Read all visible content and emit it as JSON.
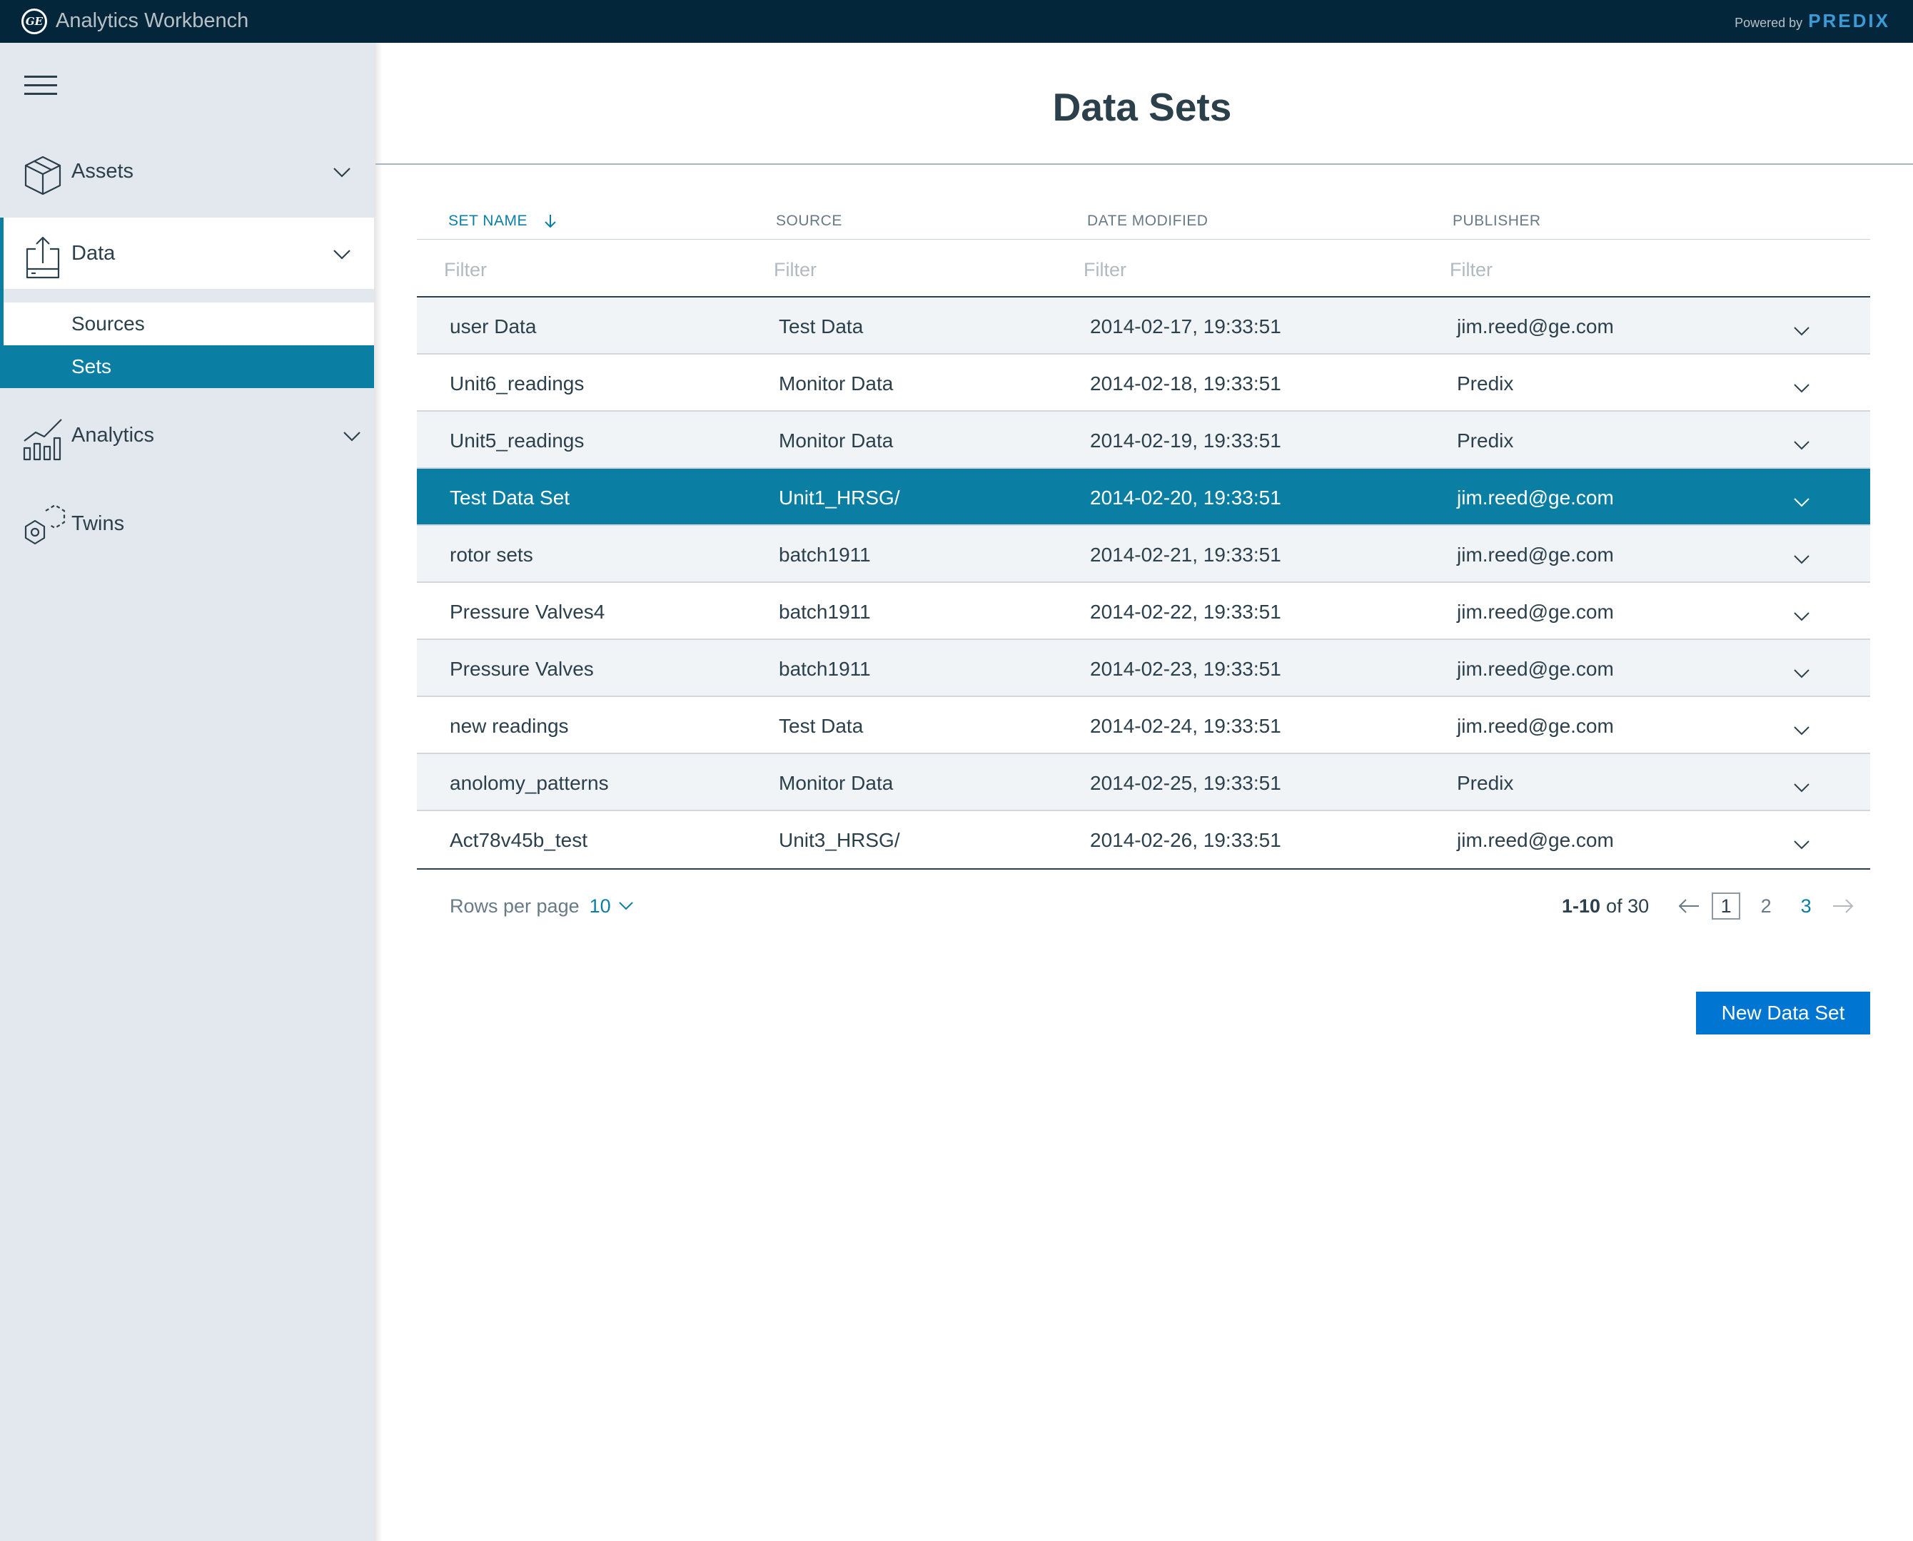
{
  "header": {
    "logo_text": "GE",
    "app_title": "Analytics Workbench",
    "powered_label": "Powered by",
    "powered_brand": "PREDIX"
  },
  "sidebar": {
    "items": [
      {
        "label": "Assets",
        "icon": "cube-icon",
        "expanded": false
      },
      {
        "label": "Data",
        "icon": "data-upload-icon",
        "expanded": true,
        "children": [
          {
            "label": "Sources",
            "selected": false
          },
          {
            "label": "Sets",
            "selected": true
          }
        ]
      },
      {
        "label": "Analytics",
        "icon": "bar-line-chart-icon",
        "expanded": false
      },
      {
        "label": "Twins",
        "icon": "twins-hexagon-icon"
      }
    ]
  },
  "main": {
    "title": "Data Sets",
    "columns": [
      "SET NAME",
      "SOURCE",
      "DATE MODIFIED",
      "PUBLISHER"
    ],
    "sorted_column": "SET NAME",
    "sort_direction": "descending",
    "filter_placeholder": "Filter",
    "rows": [
      {
        "name": "user Data",
        "source": "Test Data",
        "date": "2014-02-17, 19:33:51",
        "publisher": "jim.reed@ge.com"
      },
      {
        "name": "Unit6_readings",
        "source": "Monitor Data",
        "date": "2014-02-18, 19:33:51",
        "publisher": "Predix"
      },
      {
        "name": "Unit5_readings",
        "source": "Monitor Data",
        "date": "2014-02-19, 19:33:51",
        "publisher": "Predix"
      },
      {
        "name": "Test Data Set",
        "source": "Unit1_HRSG/",
        "date": "2014-02-20, 19:33:51",
        "publisher": "jim.reed@ge.com",
        "selected": true
      },
      {
        "name": "rotor sets",
        "source": "batch1911",
        "date": "2014-02-21, 19:33:51",
        "publisher": "jim.reed@ge.com"
      },
      {
        "name": "Pressure Valves4",
        "source": "batch1911",
        "date": "2014-02-22, 19:33:51",
        "publisher": "jim.reed@ge.com"
      },
      {
        "name": "Pressure Valves",
        "source": "batch1911",
        "date": "2014-02-23, 19:33:51",
        "publisher": "jim.reed@ge.com"
      },
      {
        "name": "new readings",
        "source": "Test Data",
        "date": "2014-02-24, 19:33:51",
        "publisher": "jim.reed@ge.com"
      },
      {
        "name": "anolomy_patterns",
        "source": "Monitor Data",
        "date": "2014-02-25, 19:33:51",
        "publisher": "Predix"
      },
      {
        "name": "Act78v45b_test",
        "source": "Unit3_HRSG/",
        "date": "2014-02-26, 19:33:51",
        "publisher": "jim.reed@ge.com"
      }
    ],
    "pagination": {
      "rows_per_page_label": "Rows per page",
      "rows_per_page_value": "10",
      "range": "1-10",
      "of_total": "of 30",
      "pages": [
        "1",
        "2",
        "3"
      ],
      "current_page": "1"
    },
    "new_button_label": "New Data Set"
  },
  "colors": {
    "topbar": "#03263a",
    "sidebar": "#e3e8ee",
    "accent": "#0b7fa3",
    "primary_button": "#0076d2",
    "brand": "#3a9bd9"
  }
}
